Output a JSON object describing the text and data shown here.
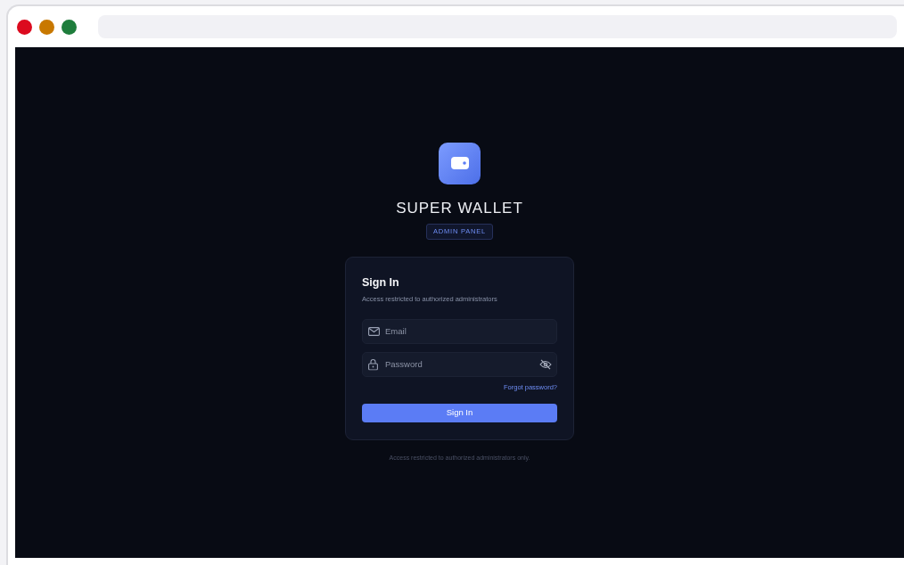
{
  "browser": {
    "traffic_lights": [
      {
        "color": "#dc0a1e"
      },
      {
        "color": "#c87800"
      },
      {
        "color": "#1e7d3c"
      }
    ]
  },
  "brand": {
    "title": "SUPER WALLET",
    "badge": "ADMIN PANEL"
  },
  "sign_in": {
    "title": "Sign In",
    "subtitle": "Access restricted to authorized administrators",
    "email": {
      "placeholder": "Email"
    },
    "password": {
      "placeholder": "Password"
    },
    "forgot_link": "Forgot password?",
    "submit": "Sign In"
  },
  "footer": "Access restricted to authorized administrators only."
}
